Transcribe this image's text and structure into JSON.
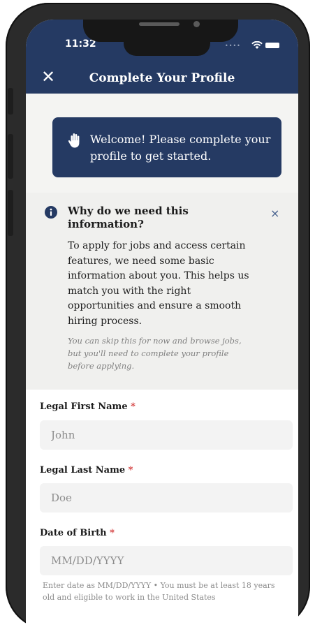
{
  "status_bar": {
    "time": "11:32"
  },
  "header": {
    "title": "Complete Your Profile",
    "close_label": "✕"
  },
  "welcome": {
    "icon": "hand-icon",
    "message": "Welcome! Please complete your profile to get started."
  },
  "info_panel": {
    "icon": "info-icon",
    "heading": "Why do we need this information?",
    "body": "To apply for jobs and access certain features, we need some basic information about you. This helps us match you with the right opportunities and ensure a smooth hiring process.",
    "note": "You can skip this for now and browse jobs, but you'll need to complete your profile before applying.",
    "dismiss_label": "×"
  },
  "form": {
    "first_name": {
      "label": "Legal First Name",
      "required_mark": "*",
      "value": "",
      "placeholder": "John"
    },
    "last_name": {
      "label": "Legal Last Name",
      "required_mark": "*",
      "value": "",
      "placeholder": "Doe"
    },
    "dob": {
      "label": "Date of Birth",
      "required_mark": "*",
      "value": "",
      "placeholder": "MM/DD/YYYY",
      "hint": "Enter date as MM/DD/YYYY • You must be at least 18 years old and eligible to work in the United States"
    }
  },
  "colors": {
    "primary": "#253a63",
    "required": "#d33a3a",
    "field_bg": "#f3f3f3"
  }
}
